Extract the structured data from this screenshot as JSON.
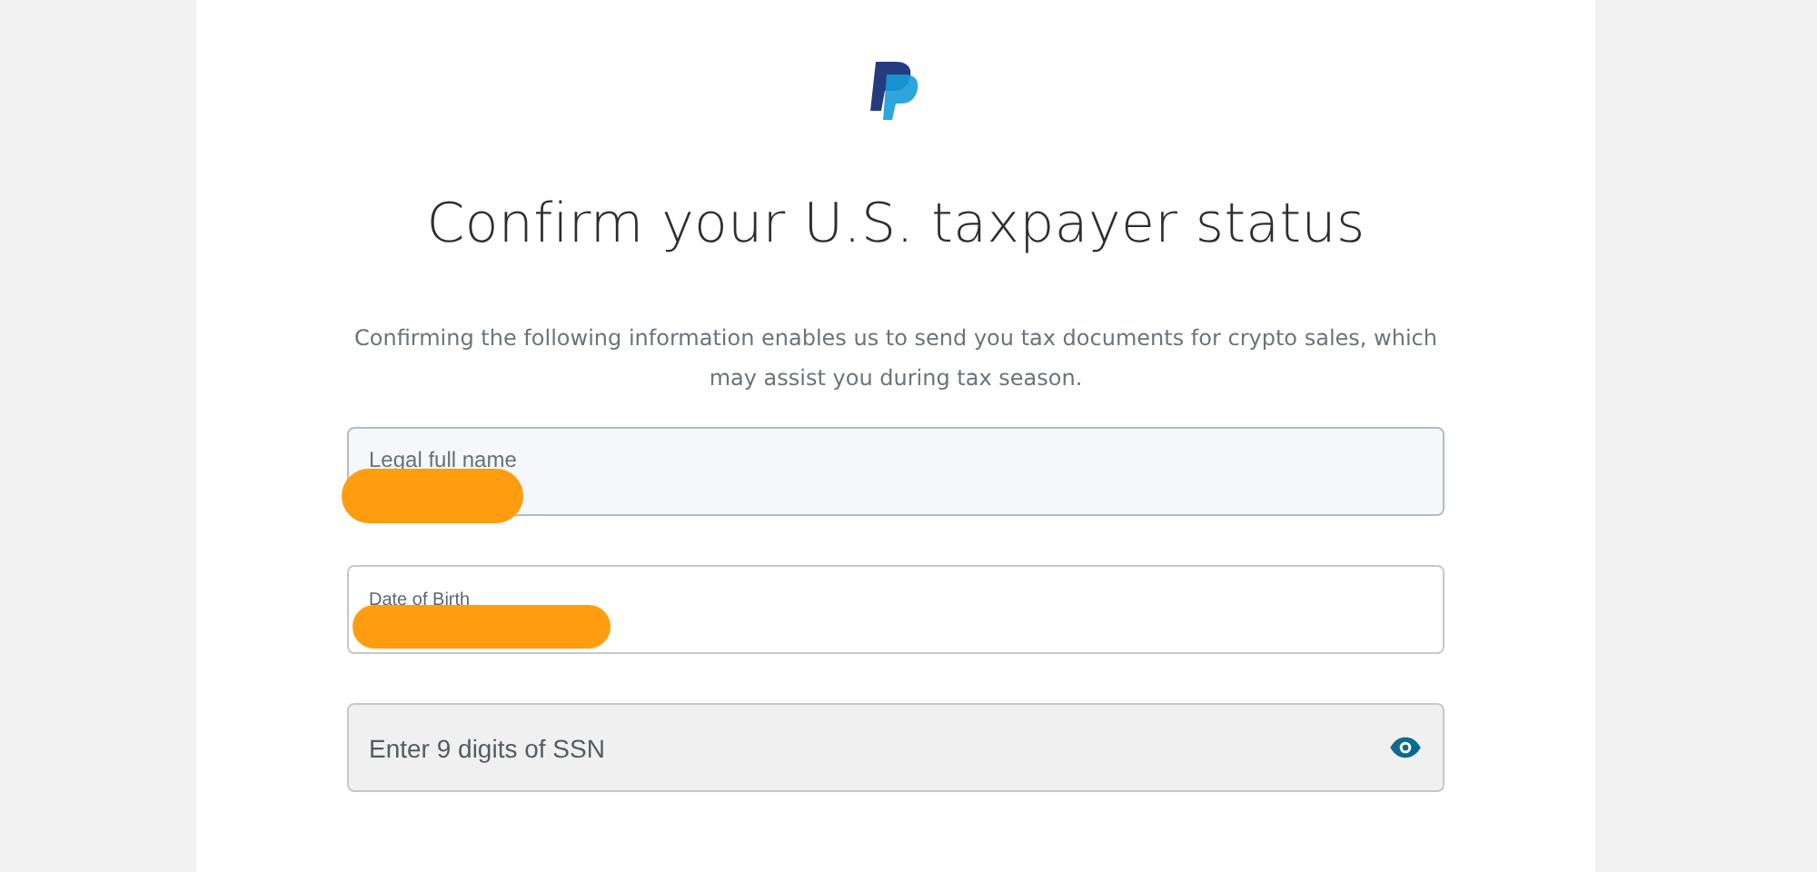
{
  "title": "Confirm your U.S. taxpayer status",
  "description": "Confirming the following information enables us to send you tax documents for crypto sales, which may assist you during tax season.",
  "fields": [
    {
      "label": "Legal full name",
      "kind": "filled",
      "focused": true
    },
    {
      "label": "Date of Birth",
      "kind": "filled",
      "focused": false
    },
    {
      "placeholder": "Enter 9 digits of SSN",
      "kind": "secret",
      "focused": false
    }
  ]
}
